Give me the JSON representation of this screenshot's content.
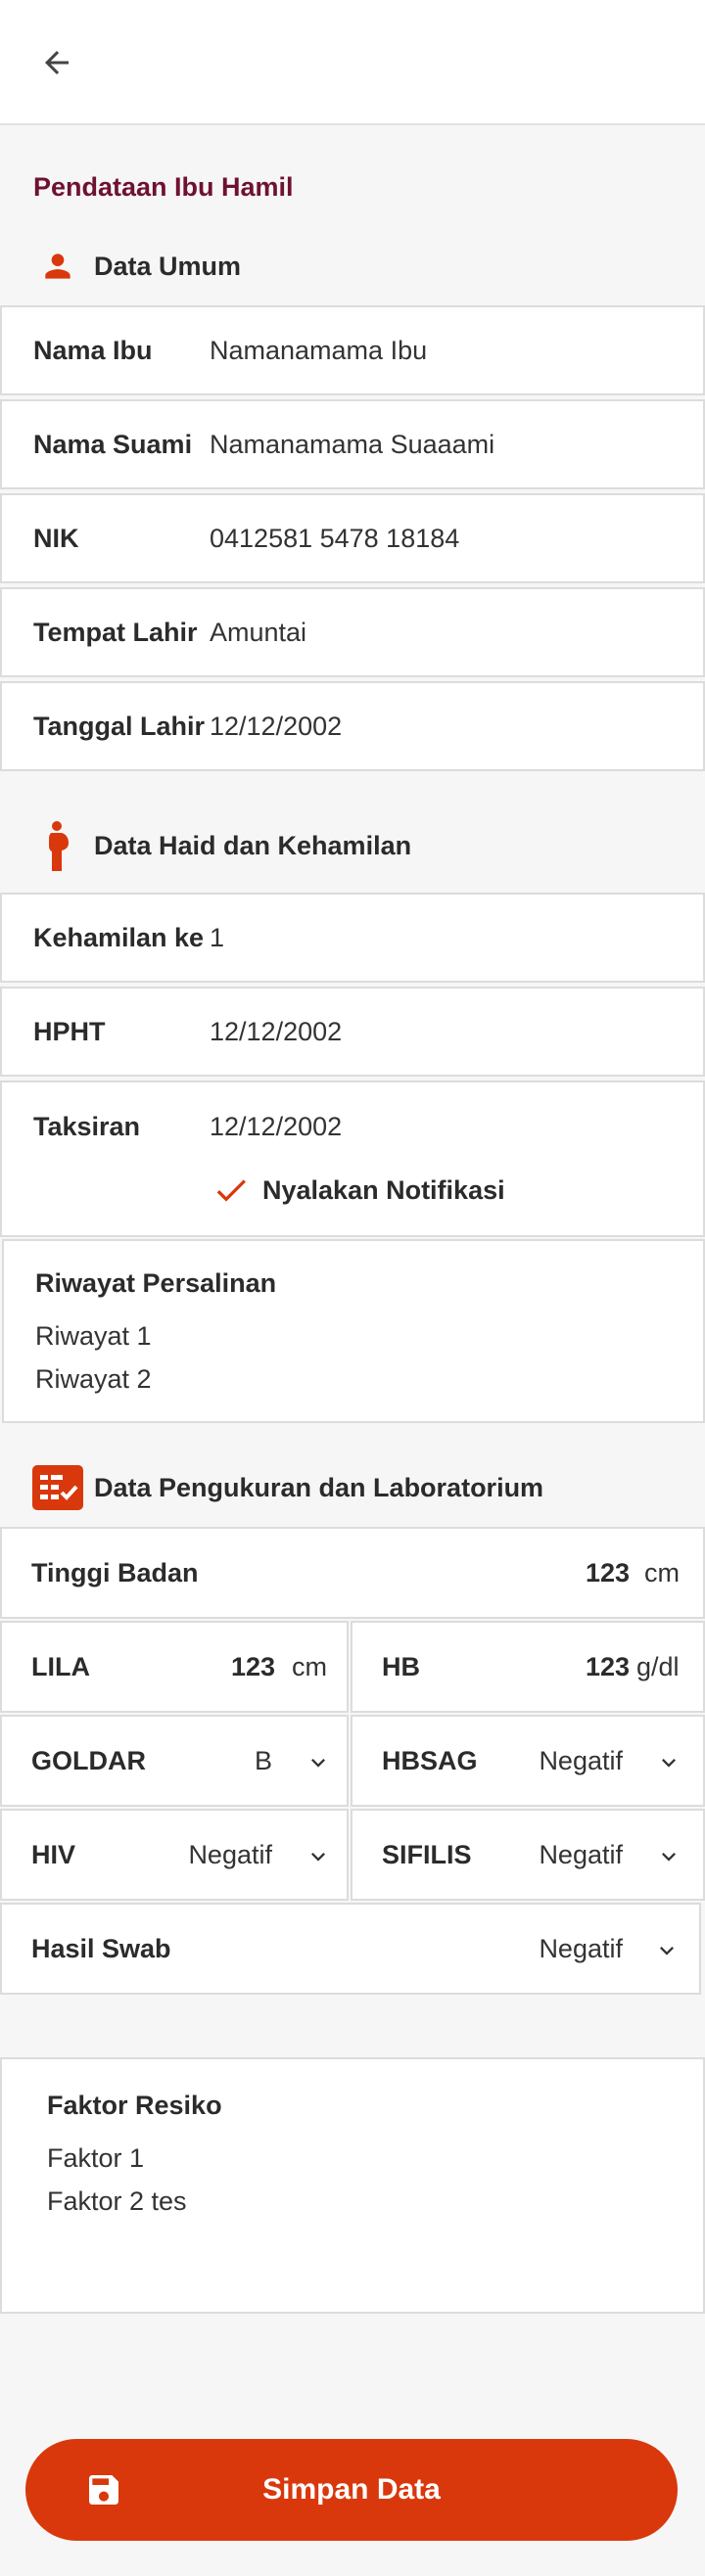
{
  "page_title": "Pendataan Ibu Hamil",
  "sections": {
    "umum": "Data Umum",
    "haid": "Data Haid dan Kehamilan",
    "lab": "Data Pengukuran dan Laboratorium"
  },
  "umum": {
    "nama_ibu": {
      "label": "Nama Ibu",
      "value": "Namanamama Ibu"
    },
    "nama_suami": {
      "label": "Nama Suami",
      "value": "Namanamama Suaaami"
    },
    "nik": {
      "label": "NIK",
      "value": "0412581 5478 18184"
    },
    "tempat_lahir": {
      "label": "Tempat Lahir",
      "value": "Amuntai"
    },
    "tanggal_lahir": {
      "label": "Tanggal Lahir",
      "value": "12/12/2002"
    }
  },
  "haid": {
    "kehamilan_ke": {
      "label": "Kehamilan ke",
      "value": "1"
    },
    "hpht": {
      "label": "HPHT",
      "value": "12/12/2002"
    },
    "taksiran": {
      "label": "Taksiran",
      "value": "12/12/2002"
    },
    "notifikasi_label": "Nyalakan Notifikasi"
  },
  "riwayat": {
    "title": "Riwayat Persalinan",
    "items": [
      "Riwayat 1",
      "Riwayat 2"
    ]
  },
  "lab": {
    "tinggi_badan": {
      "label": "Tinggi Badan",
      "value": "123",
      "unit": "cm"
    },
    "lila": {
      "label": "LILA",
      "value": "123",
      "unit": "cm"
    },
    "hb": {
      "label": "HB",
      "value": "123",
      "unit": "g/dl"
    },
    "goldar": {
      "label": "GOLDAR",
      "value": "B"
    },
    "hbsag": {
      "label": "HBSAG",
      "value": "Negatif"
    },
    "hiv": {
      "label": "HIV",
      "value": "Negatif"
    },
    "sifilis": {
      "label": "SIFILIS",
      "value": "Negatif"
    },
    "hasil_swab": {
      "label": "Hasil Swab",
      "value": "Negatif"
    }
  },
  "faktor": {
    "title": "Faktor Resiko",
    "items": [
      "Faktor 1",
      "Faktor 2 tes"
    ]
  },
  "save_label": "Simpan Data",
  "icons": {
    "back": "arrow-left-icon",
    "person": "person-icon",
    "pregnant": "pregnant-woman-icon",
    "checklist": "checklist-icon",
    "check": "check-icon",
    "chevron": "chevron-down-icon",
    "save": "floppy-disk-icon"
  },
  "colors": {
    "accent": "#d9380c",
    "title": "#6e1230",
    "background": "#f6f6f6"
  }
}
